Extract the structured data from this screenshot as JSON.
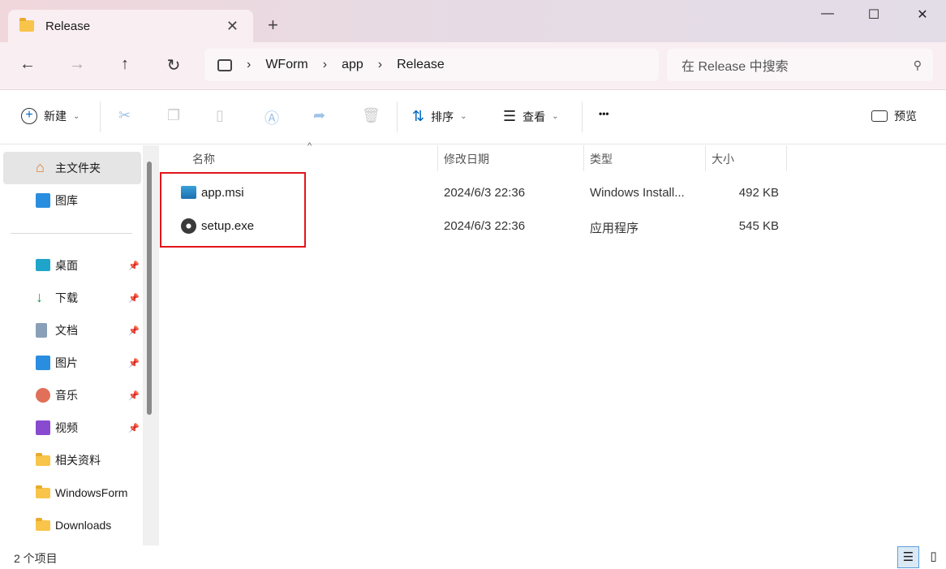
{
  "tab": {
    "title": "Release",
    "close": "✕",
    "new_tab": "+"
  },
  "window": {
    "minimize": "—",
    "maximize": "☐",
    "close": "✕"
  },
  "nav": {
    "back": "←",
    "forward": "→",
    "up": "↑",
    "refresh": "↻"
  },
  "breadcrumb": [
    "WForm",
    "app",
    "Release"
  ],
  "search": {
    "placeholder": "在 Release 中搜索"
  },
  "toolbar": {
    "new": "新建",
    "sort": "排序",
    "view": "查看",
    "more": "•••",
    "preview": "预览"
  },
  "sidebar": {
    "items": [
      {
        "label": "主文件夹",
        "icon": "home-icon",
        "pinned": false
      },
      {
        "label": "图库",
        "icon": "gallery-icon",
        "pinned": false
      },
      {
        "label": "桌面",
        "icon": "desktop-icon",
        "pinned": true
      },
      {
        "label": "下载",
        "icon": "download-icon",
        "pinned": true
      },
      {
        "label": "文档",
        "icon": "document-icon",
        "pinned": true
      },
      {
        "label": "图片",
        "icon": "pictures-icon",
        "pinned": true
      },
      {
        "label": "音乐",
        "icon": "music-icon",
        "pinned": true
      },
      {
        "label": "视频",
        "icon": "video-icon",
        "pinned": true
      },
      {
        "label": "相关资料",
        "icon": "folder-icon",
        "pinned": false
      },
      {
        "label": "WindowsForm",
        "icon": "folder-icon",
        "pinned": false
      },
      {
        "label": "Downloads",
        "icon": "folder-icon",
        "pinned": false
      }
    ]
  },
  "columns": {
    "name": "名称",
    "date": "修改日期",
    "type": "类型",
    "size": "大小"
  },
  "files": [
    {
      "name": "app.msi",
      "date": "2024/6/3 22:36",
      "type": "Windows Install...",
      "size": "492 KB",
      "icon": "msi-installer-icon"
    },
    {
      "name": "setup.exe",
      "date": "2024/6/3 22:36",
      "type": "应用程序",
      "size": "545 KB",
      "icon": "setup-exe-icon"
    }
  ],
  "status": {
    "count": "2 个项目"
  },
  "colors": {
    "highlight": "#e3141b",
    "accent": "#0067c0"
  }
}
